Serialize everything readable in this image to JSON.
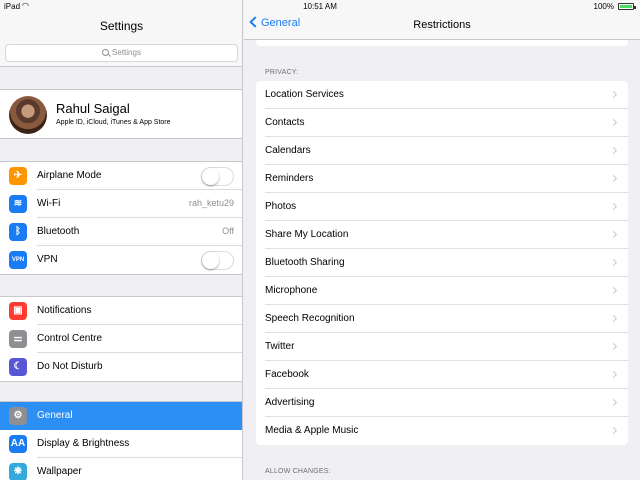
{
  "status": {
    "device": "iPad",
    "time": "10:51 AM",
    "battery": "100%",
    "battery_level": 1.0
  },
  "left": {
    "title": "Settings",
    "search_placeholder": "Settings",
    "profile": {
      "name": "Rahul Saigal",
      "subtitle": "Apple ID, iCloud, iTunes & App Store"
    },
    "group1": [
      {
        "label": "Airplane Mode",
        "icon": "airplane-icon",
        "glyph": "✈",
        "color": "#ff9500",
        "toggle": true,
        "on": false
      },
      {
        "label": "Wi-Fi",
        "icon": "wifi-icon",
        "glyph": "≋",
        "color": "#1a7cf5",
        "value": "rah_ketu29"
      },
      {
        "label": "Bluetooth",
        "icon": "bluetooth-icon",
        "glyph": "ᛒ",
        "color": "#1a7cf5",
        "value": "Off"
      },
      {
        "label": "VPN",
        "icon": "vpn-icon",
        "glyph": "VPN",
        "color": "#1a7cf5",
        "toggle": true,
        "on": false
      }
    ],
    "group2": [
      {
        "label": "Notifications",
        "icon": "notifications-icon",
        "glyph": "▣",
        "color": "#ff3b30"
      },
      {
        "label": "Control Centre",
        "icon": "control-centre-icon",
        "glyph": "⚌",
        "color": "#8e8e93"
      },
      {
        "label": "Do Not Disturb",
        "icon": "moon-icon",
        "glyph": "☾",
        "color": "#5856d6"
      }
    ],
    "group3": [
      {
        "label": "General",
        "icon": "gear-icon",
        "glyph": "⚙",
        "color": "#8e8e93",
        "selected": true
      },
      {
        "label": "Display & Brightness",
        "icon": "display-icon",
        "glyph": "AA",
        "color": "#1a7cf5"
      },
      {
        "label": "Wallpaper",
        "icon": "wallpaper-icon",
        "glyph": "❋",
        "color": "#34aadc"
      }
    ]
  },
  "right": {
    "back_label": "General",
    "title": "Restrictions",
    "privacy_header": "PRIVACY:",
    "privacy_items": [
      "Location Services",
      "Contacts",
      "Calendars",
      "Reminders",
      "Photos",
      "Share My Location",
      "Bluetooth Sharing",
      "Microphone",
      "Speech Recognition",
      "Twitter",
      "Facebook",
      "Advertising",
      "Media & Apple Music"
    ],
    "allow_changes_header": "ALLOW CHANGES:"
  }
}
